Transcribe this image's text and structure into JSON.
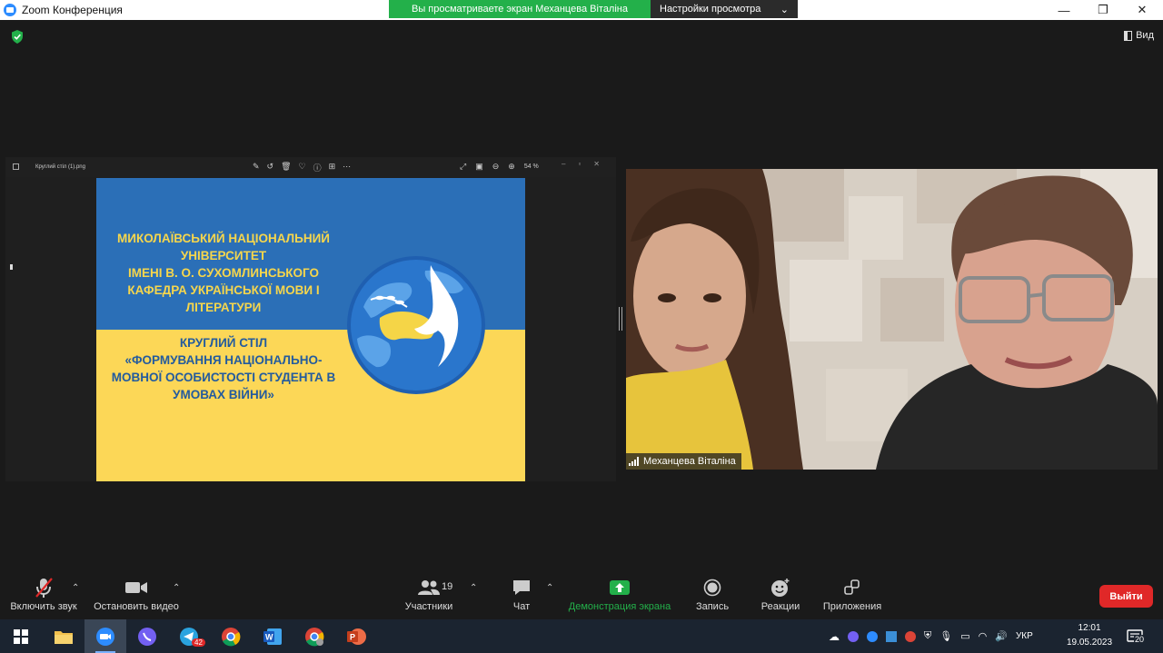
{
  "titlebar": {
    "app_title": "Zoom Конференция",
    "share_banner": "Вы просматриваете экран Механцева Віталіна",
    "view_settings": "Настройки просмотра"
  },
  "top": {
    "view_label": "Вид"
  },
  "viewer": {
    "filename": "Круглий стіл (1).png",
    "zoom": "54 %"
  },
  "slide": {
    "university": [
      "МИКОЛАЇВСЬКИЙ НАЦІОНАЛЬНИЙ",
      "УНІВЕРСИТЕТ",
      "ІМЕНІ В. О. СУХОМЛИНСЬКОГО",
      "КАФЕДРА УКРАЇНСЬКОЇ МОВИ І",
      "ЛІТЕРАТУРИ"
    ],
    "event": [
      "КРУГЛИЙ СТІЛ",
      "«ФОРМУВАННЯ НАЦІОНАЛЬНО-",
      "МОВНОЇ ОСОБИСТОСТІ СТУДЕНТА В",
      "УМОВАХ ВІЙНИ»"
    ]
  },
  "video": {
    "participant_name": "Механцева Віталіна"
  },
  "toolbar": {
    "unmute": "Включить звук",
    "stop_video": "Остановить видео",
    "participants": "Участники",
    "participants_count": "19",
    "chat": "Чат",
    "share_screen": "Демонстрация экрана",
    "record": "Запись",
    "reactions": "Реакции",
    "apps": "Приложения",
    "leave": "Выйти"
  },
  "taskbar": {
    "telegram_badge": "42",
    "language": "УКР",
    "time": "12:01",
    "date": "19.05.2023",
    "notifications": "20"
  },
  "colors": {
    "share_green": "#23b04a",
    "leave_red": "#e02828",
    "slide_blue": "#2b6fb7",
    "slide_yellow": "#fcd757"
  }
}
